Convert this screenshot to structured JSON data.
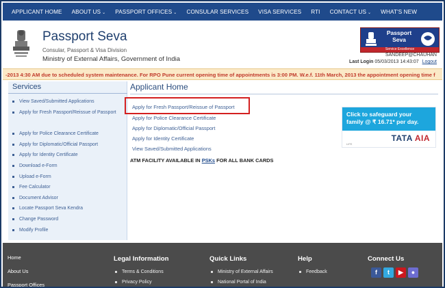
{
  "topnav": {
    "items": [
      {
        "label": "APPLICANT HOME",
        "dropdown": false
      },
      {
        "label": "ABOUT US",
        "dropdown": true
      },
      {
        "label": "PASSPORT OFFICES",
        "dropdown": true
      },
      {
        "label": "CONSULAR SERVICES",
        "dropdown": false
      },
      {
        "label": "VISA SERVICES",
        "dropdown": false
      },
      {
        "label": "RTI",
        "dropdown": false
      },
      {
        "label": "CONTACT US",
        "dropdown": true
      },
      {
        "label": "WHAT'S NEW",
        "dropdown": false
      }
    ],
    "caret": "⌄"
  },
  "header": {
    "title": "Passport Seva",
    "subtitle": "Consular, Passport & Visa Division",
    "ministry": "Ministry of External Affairs, Government of India",
    "logo_line1": "Passport",
    "logo_line2": "Seva",
    "logo_strip": "Service Excellence",
    "user": "SANDEEP@CHAUHAN",
    "last_login_label": "Last Login",
    "last_login_value": "05/03/2013 14:43:07",
    "logout": "Logout"
  },
  "ticker": {
    "text": "-2013 4:30 AM due to scheduled system maintenance. For RPO Pune current opening time of appointments is 3:00 PM. W.e.f. 11th March, 2013 the appointment opening time f"
  },
  "sidebar": {
    "title": "Services",
    "items": [
      {
        "label": "View Saved/Submitted Applications"
      },
      {
        "label": "Apply for Fresh Passport/Reissue of Passport"
      },
      {
        "label": "Apply for Police Clearance Certificate"
      },
      {
        "label": "Apply for Diplomatic/Official Passport"
      },
      {
        "label": "Apply for Identity Certificate"
      },
      {
        "label": "Download e-Form"
      },
      {
        "label": "Upload e-Form"
      },
      {
        "label": "Fee Calculator"
      },
      {
        "label": "Document Advisor"
      },
      {
        "label": "Locate Passport Seva Kendra"
      },
      {
        "label": "Change Password"
      },
      {
        "label": "Modify Profile"
      }
    ]
  },
  "main": {
    "title": "Applicant Home",
    "links": [
      {
        "label": "Apply for Fresh Passport/Reissue of Passport"
      },
      {
        "label": "Apply for Police Clearance Certificate"
      },
      {
        "label": "Apply for Diplomatic/Official Passport"
      },
      {
        "label": "Apply for Identity Certificate"
      },
      {
        "label": "View Saved/Submitted Applications"
      }
    ],
    "atm_prefix": "ATM FACILITY AVAILABLE IN",
    "atm_psk": "PSKs",
    "atm_suffix": "FOR ALL BANK CARDS"
  },
  "ad": {
    "line1": "Click to safeguard your",
    "line2": "family @ ₹ 16.71* per day.",
    "brand_tata": "TATA",
    "brand_aia": "AIA",
    "brand_life": "LIFE"
  },
  "footer": {
    "left": [
      "Home",
      "About Us",
      "Passport Offices"
    ],
    "legal": {
      "heading": "Legal Information",
      "links": [
        "Terms & Conditions",
        "Privacy Policy"
      ]
    },
    "quick": {
      "heading": "Quick Links",
      "links": [
        "Ministry of External Affairs",
        "National Portal of India"
      ]
    },
    "help": {
      "heading": "Help",
      "links": [
        "Feedback"
      ]
    },
    "connect": {
      "heading": "Connect Us",
      "icons": [
        "facebook-icon",
        "twitter-icon",
        "youtube-icon",
        "flickr-icon"
      ]
    }
  },
  "colors": {
    "nav_bg": "#1f4a8b",
    "ticker_text": "#c0392b",
    "highlight": "#d31f1f",
    "footer_bg": "#4b4b4b"
  }
}
